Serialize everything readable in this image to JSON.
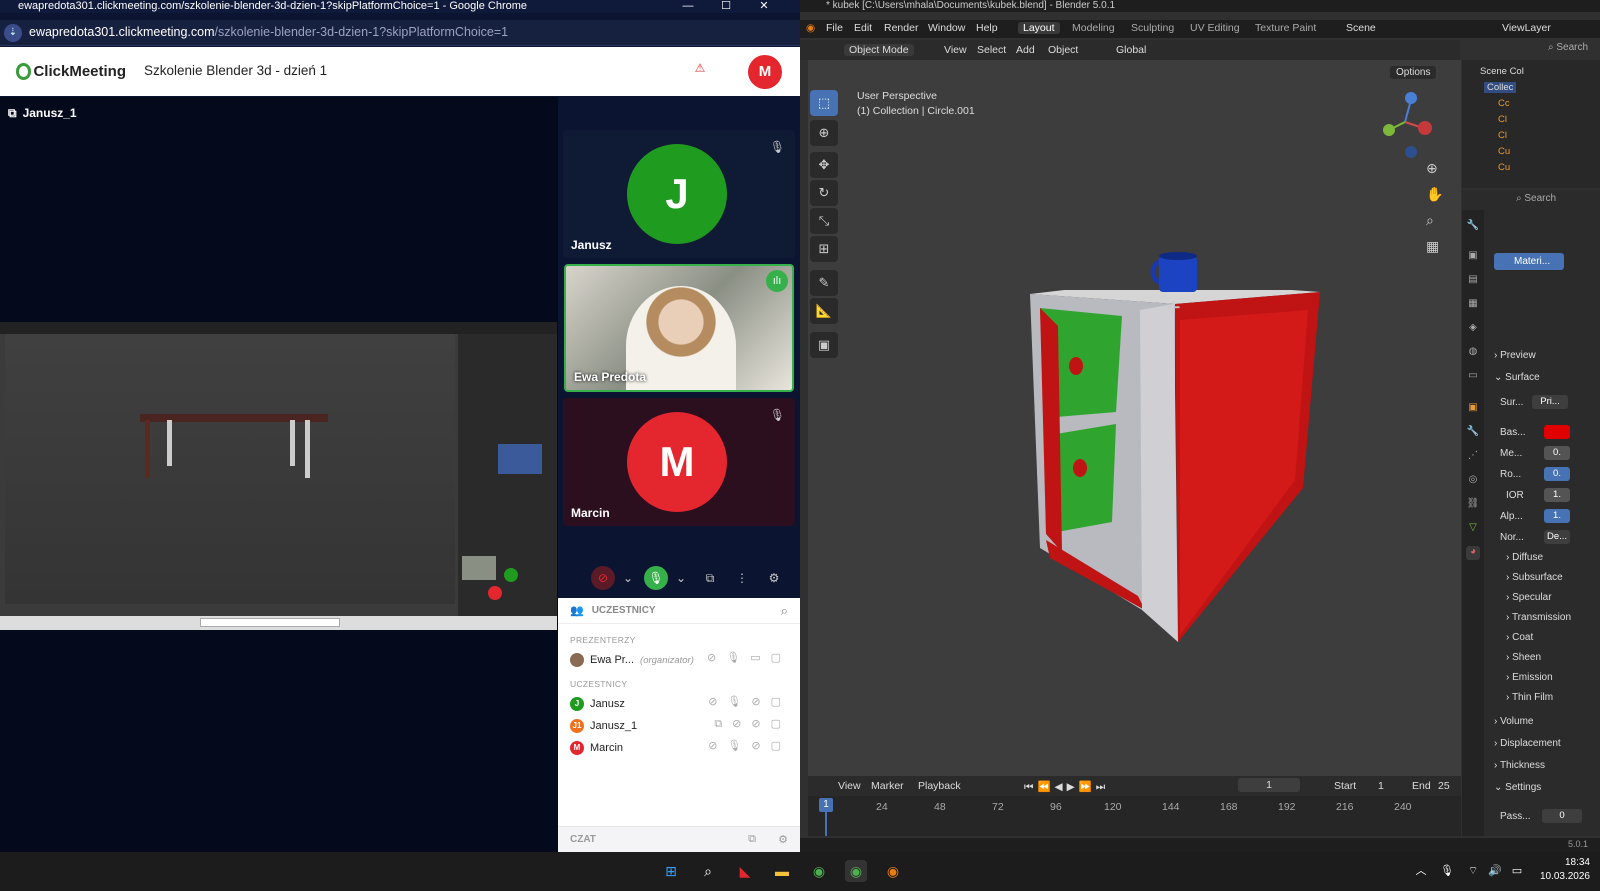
{
  "chrome": {
    "window_title": "ewapredota301.clickmeeting.com/szkolenie-blender-3d-dzien-1?skipPlatformChoice=1 - Google Chrome",
    "url_host": "ewapredota301.clickmeeting.com",
    "url_path": "/szkolenie-blender-3d-dzien-1?skipPlatformChoice=1",
    "win_min": "—",
    "win_max": "☐",
    "win_close": "✕"
  },
  "clickmeeting": {
    "logo": "ClickMeeting",
    "title": "Szkolenie Blender 3d - dzień 1",
    "user_initial": "M",
    "share_label": "Janusz_1",
    "tiles": [
      {
        "initial": "J",
        "name": "Janusz",
        "color": "#1f9b1f"
      },
      {
        "name": "Ewa Predota"
      },
      {
        "initial": "M",
        "name": "Marcin",
        "color": "#e4262f"
      }
    ],
    "participants_header": "UCZESTNICY",
    "presenters_label": "PREZENTERZY",
    "attendees_label": "UCZESTNICY",
    "presenter": {
      "name": "Ewa Pr...",
      "role": "(organizator)"
    },
    "attendees": [
      {
        "initial": "J",
        "name": "Janusz",
        "color": "#1f9b1f"
      },
      {
        "initial": "J1",
        "name": "Janusz_1",
        "color": "#f0701e"
      },
      {
        "initial": "M",
        "name": "Marcin",
        "color": "#e4262f"
      }
    ],
    "chat_label": "CZAT"
  },
  "blender": {
    "title": "* kubek [C:\\Users\\mhala\\Documents\\kubek.blend] - Blender 5.0.1",
    "menu": [
      "File",
      "Edit",
      "Render",
      "Window",
      "Help"
    ],
    "workspaces": [
      "Layout",
      "Modeling",
      "Sculpting",
      "UV Editing",
      "Texture Paint"
    ],
    "scene": "Scene",
    "view_layer": "ViewLayer",
    "header": {
      "mode": "Object Mode",
      "view": "View",
      "select": "Select",
      "add": "Add",
      "object": "Object",
      "transform": "Global",
      "options": "Options"
    },
    "viewport_line1": "User Perspective",
    "viewport_line2": "(1) Collection | Circle.001",
    "timeline": {
      "view": "View",
      "marker": "Marker",
      "playback": "Playback",
      "frame": "1",
      "start_label": "Start",
      "start": "1",
      "end_label": "End",
      "end": "25"
    },
    "ticks": [
      "24",
      "48",
      "72",
      "96",
      "120",
      "144",
      "168",
      "192",
      "216",
      "240"
    ],
    "current_frame": "1",
    "outliner": {
      "search": "Search",
      "scene_col": "Scene Col",
      "collection": "Collec",
      "items": [
        "Cc",
        "Cl",
        "Cl",
        "Cu",
        "Cu"
      ]
    },
    "props": {
      "search": "Search",
      "material": "Materi...",
      "preview": "Preview",
      "surface": "Surface",
      "surface_val": "Pri...",
      "fields": [
        {
          "label": "Sur...",
          "value": "Pri..."
        },
        {
          "label": "Bas...",
          "value": ""
        },
        {
          "label": "Me...",
          "value": "0."
        },
        {
          "label": "Ro...",
          "value": "0."
        },
        {
          "label": "IOR",
          "value": "1."
        },
        {
          "label": "Alp...",
          "value": "1."
        },
        {
          "label": "Nor...",
          "value": "De..."
        }
      ],
      "subsections": [
        "Diffuse",
        "Subsurface",
        "Specular",
        "Transmission",
        "Coat",
        "Sheen",
        "Emission",
        "Thin Film"
      ],
      "sections": [
        "Volume",
        "Displacement",
        "Thickness",
        "Settings"
      ],
      "pass_label": "Pass...",
      "pass_value": "0",
      "base_color": "#e00000"
    },
    "version": "5.0.1"
  },
  "taskbar": {
    "time": "18:34",
    "date": "10.03.2026"
  }
}
